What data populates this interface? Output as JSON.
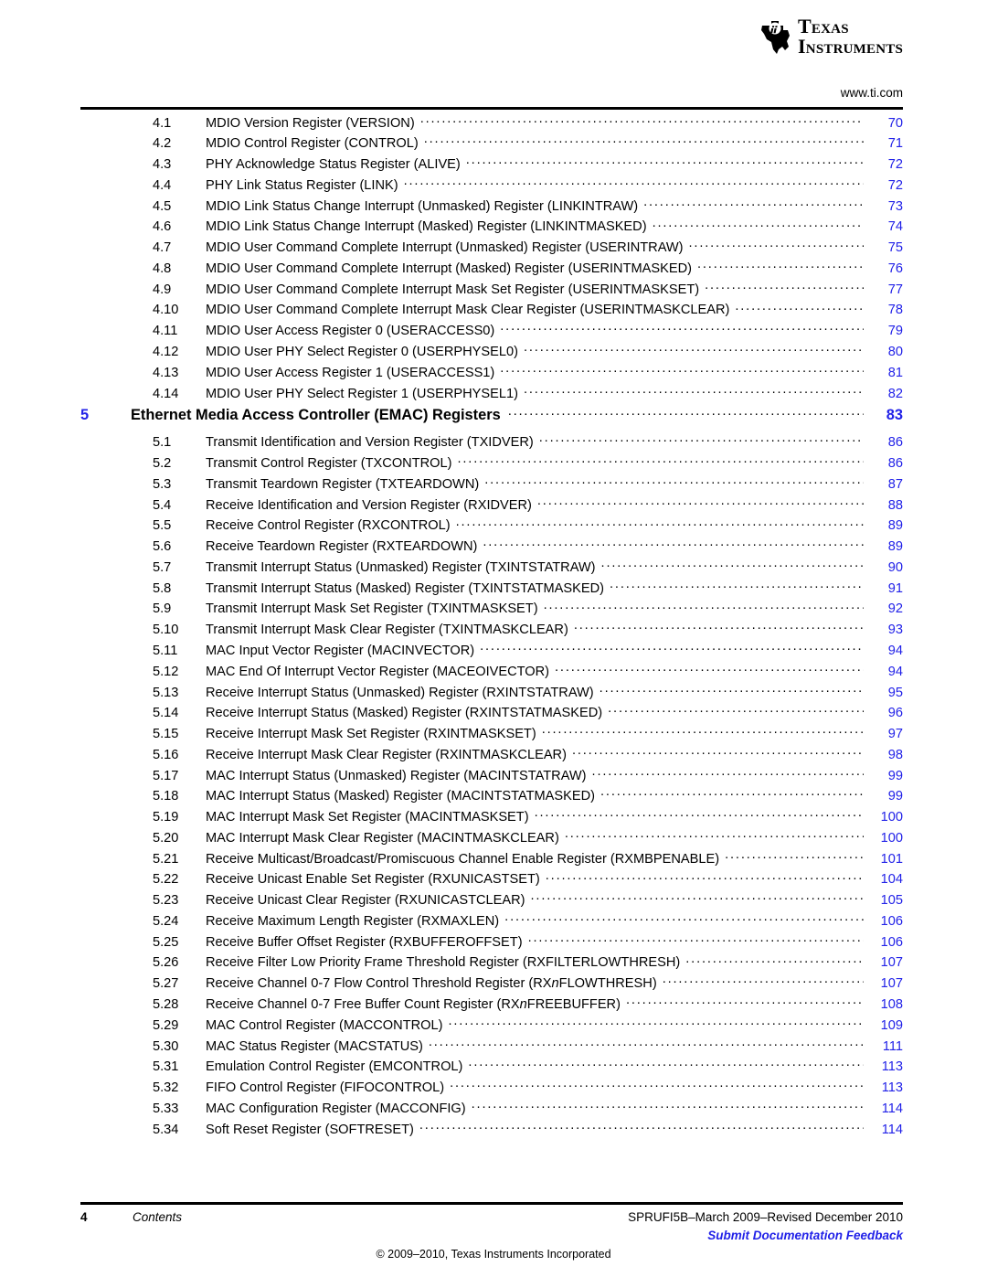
{
  "header": {
    "logo_line1": "Texas",
    "logo_line2": "Instruments",
    "logo_icon": "ti-texas-logo-icon",
    "site_url": "www.ti.com"
  },
  "toc": {
    "entries": [
      {
        "number": "4.1",
        "title": "MDIO Version Register (VERSION)",
        "page": "70",
        "level": "section"
      },
      {
        "number": "4.2",
        "title": "MDIO Control Register (CONTROL)",
        "page": "71",
        "level": "section"
      },
      {
        "number": "4.3",
        "title": "PHY Acknowledge Status Register (ALIVE)",
        "page": "72",
        "level": "section"
      },
      {
        "number": "4.4",
        "title": "PHY Link Status Register (LINK)",
        "page": "72",
        "level": "section"
      },
      {
        "number": "4.5",
        "title": "MDIO Link Status Change Interrupt (Unmasked) Register (LINKINTRAW)",
        "page": "73",
        "level": "section"
      },
      {
        "number": "4.6",
        "title": "MDIO Link Status Change Interrupt (Masked) Register (LINKINTMASKED)",
        "page": "74",
        "level": "section"
      },
      {
        "number": "4.7",
        "title": "MDIO User Command Complete Interrupt (Unmasked) Register (USERINTRAW)",
        "page": "75",
        "level": "section"
      },
      {
        "number": "4.8",
        "title": "MDIO User Command Complete Interrupt (Masked) Register (USERINTMASKED)",
        "page": "76",
        "level": "section"
      },
      {
        "number": "4.9",
        "title": "MDIO User Command Complete Interrupt Mask Set Register (USERINTMASKSET)",
        "page": "77",
        "level": "section"
      },
      {
        "number": "4.10",
        "title": "MDIO User Command Complete Interrupt Mask Clear Register (USERINTMASKCLEAR)",
        "page": "78",
        "level": "section"
      },
      {
        "number": "4.11",
        "title": "MDIO User Access Register 0 (USERACCESS0)",
        "page": "79",
        "level": "section"
      },
      {
        "number": "4.12",
        "title": "MDIO User PHY Select Register 0 (USERPHYSEL0)",
        "page": "80",
        "level": "section"
      },
      {
        "number": "4.13",
        "title": "MDIO User Access Register 1 (USERACCESS1)",
        "page": "81",
        "level": "section"
      },
      {
        "number": "4.14",
        "title": "MDIO User PHY Select Register 1 (USERPHYSEL1)",
        "page": "82",
        "level": "section"
      },
      {
        "number": "5",
        "title": "Ethernet Media Access Controller (EMAC) Registers",
        "page": "83",
        "level": "chapter"
      },
      {
        "number": "5.1",
        "title": "Transmit Identification and Version Register (TXIDVER)",
        "page": "86",
        "level": "section"
      },
      {
        "number": "5.2",
        "title": "Transmit Control Register (TXCONTROL)",
        "page": "86",
        "level": "section"
      },
      {
        "number": "5.3",
        "title": "Transmit Teardown Register (TXTEARDOWN)",
        "page": "87",
        "level": "section"
      },
      {
        "number": "5.4",
        "title": "Receive Identification and Version Register (RXIDVER)",
        "page": "88",
        "level": "section"
      },
      {
        "number": "5.5",
        "title": "Receive Control Register (RXCONTROL)",
        "page": "89",
        "level": "section"
      },
      {
        "number": "5.6",
        "title": "Receive Teardown Register (RXTEARDOWN)",
        "page": "89",
        "level": "section"
      },
      {
        "number": "5.7",
        "title": "Transmit Interrupt Status (Unmasked) Register (TXINTSTATRAW)",
        "page": "90",
        "level": "section"
      },
      {
        "number": "5.8",
        "title": "Transmit Interrupt Status (Masked) Register (TXINTSTATMASKED)",
        "page": "91",
        "level": "section"
      },
      {
        "number": "5.9",
        "title": "Transmit Interrupt Mask Set Register (TXINTMASKSET)",
        "page": "92",
        "level": "section"
      },
      {
        "number": "5.10",
        "title": "Transmit Interrupt Mask Clear Register (TXINTMASKCLEAR)",
        "page": "93",
        "level": "section"
      },
      {
        "number": "5.11",
        "title": "MAC Input Vector Register (MACINVECTOR)",
        "page": "94",
        "level": "section"
      },
      {
        "number": "5.12",
        "title": "MAC End Of Interrupt Vector Register (MACEOIVECTOR)",
        "page": "94",
        "level": "section"
      },
      {
        "number": "5.13",
        "title": "Receive Interrupt Status (Unmasked) Register (RXINTSTATRAW)",
        "page": "95",
        "level": "section"
      },
      {
        "number": "5.14",
        "title": "Receive Interrupt Status (Masked) Register (RXINTSTATMASKED)",
        "page": "96",
        "level": "section"
      },
      {
        "number": "5.15",
        "title": "Receive Interrupt Mask Set Register (RXINTMASKSET)",
        "page": "97",
        "level": "section"
      },
      {
        "number": "5.16",
        "title": "Receive Interrupt Mask Clear Register (RXINTMASKCLEAR)",
        "page": "98",
        "level": "section"
      },
      {
        "number": "5.17",
        "title": "MAC Interrupt Status (Unmasked) Register (MACINTSTATRAW)",
        "page": "99",
        "level": "section"
      },
      {
        "number": "5.18",
        "title": "MAC Interrupt Status (Masked) Register (MACINTSTATMASKED)",
        "page": "99",
        "level": "section"
      },
      {
        "number": "5.19",
        "title": "MAC Interrupt Mask Set Register (MACINTMASKSET)",
        "page": "100",
        "level": "section"
      },
      {
        "number": "5.20",
        "title": "MAC Interrupt Mask Clear Register (MACINTMASKCLEAR)",
        "page": "100",
        "level": "section"
      },
      {
        "number": "5.21",
        "title": "Receive Multicast/Broadcast/Promiscuous Channel Enable Register (RXMBPENABLE)",
        "page": "101",
        "level": "section"
      },
      {
        "number": "5.22",
        "title": "Receive Unicast Enable Set Register (RXUNICASTSET)",
        "page": "104",
        "level": "section"
      },
      {
        "number": "5.23",
        "title": "Receive Unicast Clear Register (RXUNICASTCLEAR)",
        "page": "105",
        "level": "section"
      },
      {
        "number": "5.24",
        "title": "Receive Maximum Length Register (RXMAXLEN)",
        "page": "106",
        "level": "section"
      },
      {
        "number": "5.25",
        "title": "Receive Buffer Offset Register (RXBUFFEROFFSET)",
        "page": "106",
        "level": "section"
      },
      {
        "number": "5.26",
        "title": "Receive Filter Low Priority Frame Threshold Register (RXFILTERLOWTHRESH)",
        "page": "107",
        "level": "section"
      },
      {
        "number": "5.27",
        "title": "Receive Channel 0-7 Flow Control Threshold Register (RX",
        "title_italic": "n",
        "title_after": "FLOWTHRESH)",
        "page": "107",
        "level": "section"
      },
      {
        "number": "5.28",
        "title": "Receive Channel 0-7 Free Buffer Count Register (RX",
        "title_italic": "n",
        "title_after": "FREEBUFFER)",
        "page": "108",
        "level": "section"
      },
      {
        "number": "5.29",
        "title": "MAC Control Register (MACCONTROL)",
        "page": "109",
        "level": "section"
      },
      {
        "number": "5.30",
        "title": "MAC Status Register (MACSTATUS)",
        "page": "111",
        "level": "section"
      },
      {
        "number": "5.31",
        "title": "Emulation Control Register (EMCONTROL)",
        "page": "113",
        "level": "section"
      },
      {
        "number": "5.32",
        "title": "FIFO Control Register (FIFOCONTROL)",
        "page": "113",
        "level": "section"
      },
      {
        "number": "5.33",
        "title": "MAC Configuration Register (MACCONFIG)",
        "page": "114",
        "level": "section"
      },
      {
        "number": "5.34",
        "title": "Soft Reset Register (SOFTRESET)",
        "page": "114",
        "level": "section"
      }
    ]
  },
  "footer": {
    "page_number": "4",
    "section_name": "Contents",
    "document_id": "SPRUFI5B–March 2009–Revised December 2010",
    "feedback_link": "Submit Documentation Feedback",
    "copyright": "© 2009–2010, Texas Instruments Incorporated"
  },
  "colors": {
    "link_blue": "#2222e8",
    "text_black": "#000000"
  }
}
